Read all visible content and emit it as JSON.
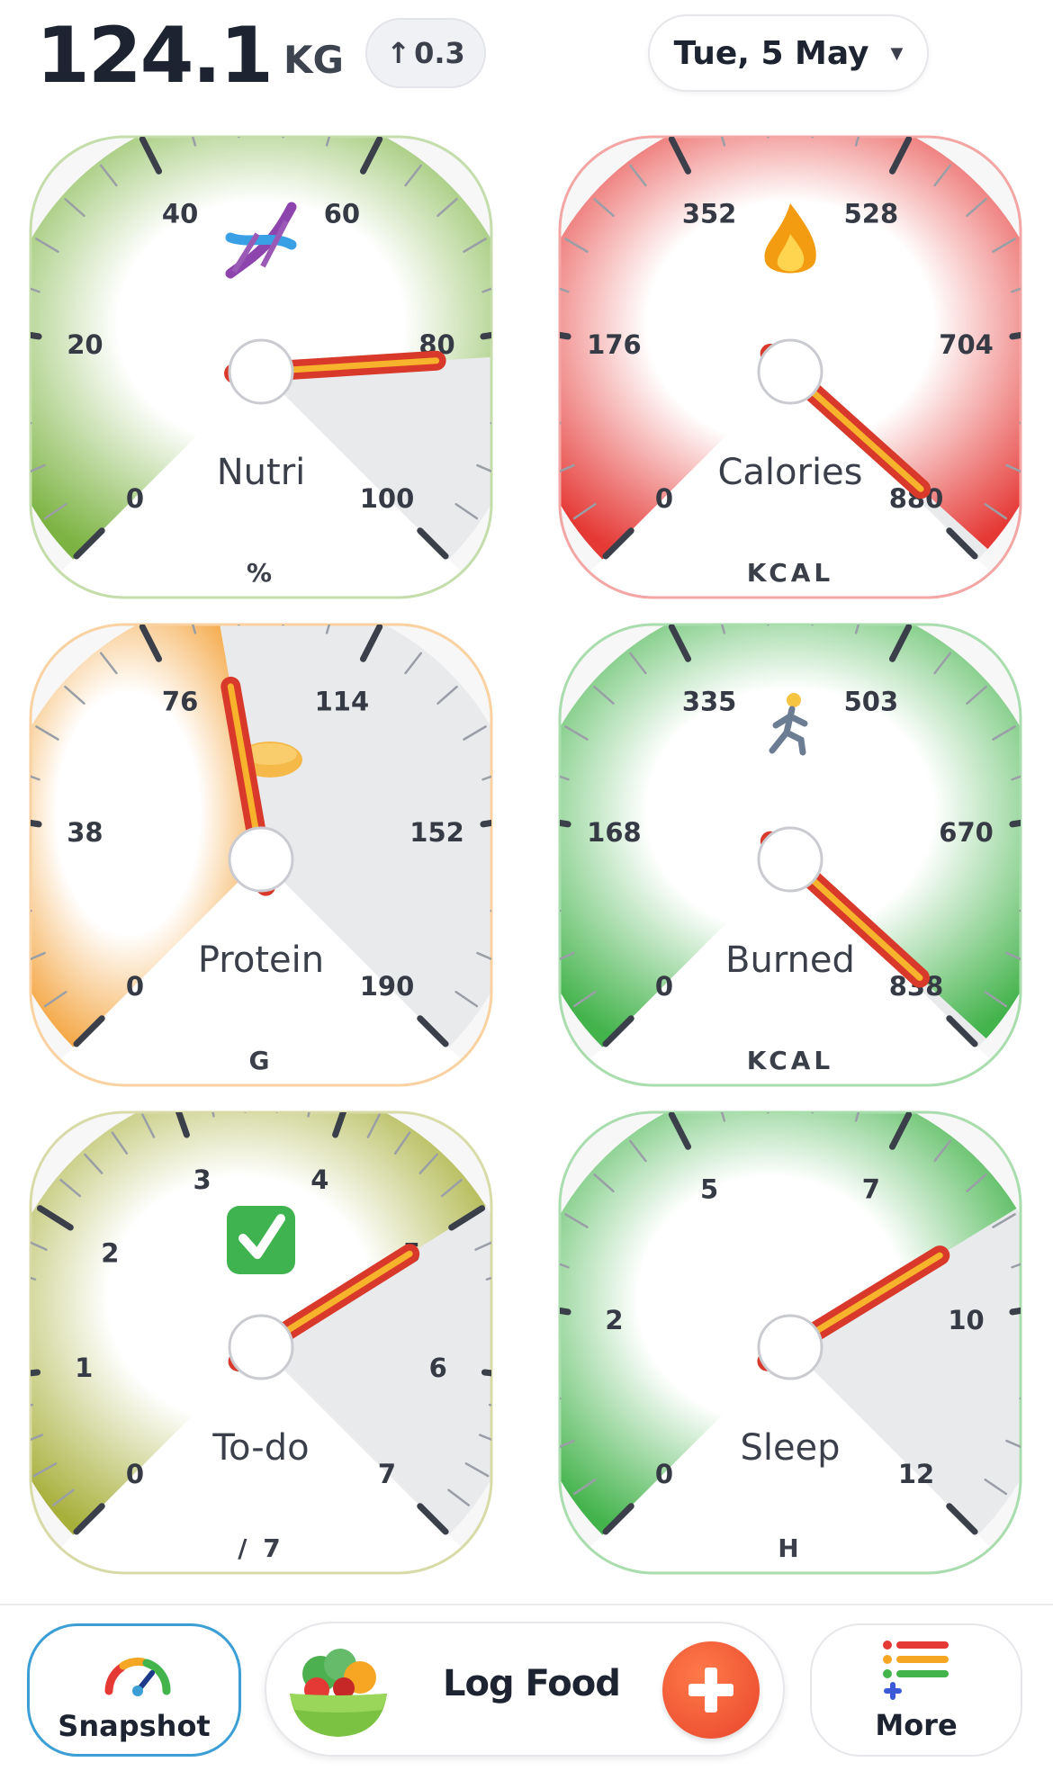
{
  "header": {
    "weight_value": "124.1",
    "weight_unit": "KG",
    "weight_delta": "0.3",
    "date": "Tue, 5 May"
  },
  "gauges": [
    {
      "id": "nutri",
      "label": "Nutri",
      "unit": "%",
      "ticks": [
        "0",
        "20",
        "40",
        "60",
        "80",
        "100"
      ],
      "value": 82,
      "max": 100,
      "color": "#7cb342",
      "icon": "dna-icon"
    },
    {
      "id": "calories",
      "label": "Calories",
      "unit": "KCAL",
      "ticks": [
        "0",
        "176",
        "352",
        "528",
        "704",
        "880"
      ],
      "value": 870,
      "max": 880,
      "color": "#e53935",
      "icon": "fire-icon"
    },
    {
      "id": "protein",
      "label": "Protein",
      "unit": "G",
      "ticks": [
        "0",
        "38",
        "76",
        "114",
        "152",
        "190"
      ],
      "value": 88,
      "max": 190,
      "color": "#f39c2e",
      "icon": "bread-icon"
    },
    {
      "id": "burned",
      "label": "Burned",
      "unit": "KCAL",
      "ticks": [
        "0",
        "168",
        "335",
        "503",
        "670",
        "838"
      ],
      "value": 830,
      "max": 838,
      "color": "#43b34b",
      "icon": "runner-icon"
    },
    {
      "id": "todo",
      "label": "To-do",
      "unit": "/ 7",
      "ticks": [
        "0",
        "1",
        "2",
        "3",
        "4",
        "5",
        "6",
        "7"
      ],
      "value": 5,
      "max": 7,
      "color": "#a8b03c",
      "icon": "check-icon"
    },
    {
      "id": "sleep",
      "label": "Sleep",
      "unit": "H",
      "ticks": [
        "0",
        "2",
        "5",
        "7",
        "10",
        "12"
      ],
      "value": 8.6,
      "max": 12,
      "color": "#43b34b",
      "icon": "moon-icon"
    }
  ],
  "footer": {
    "snapshot_label": "Snapshot",
    "log_food_label": "Log Food",
    "more_label": "More"
  }
}
